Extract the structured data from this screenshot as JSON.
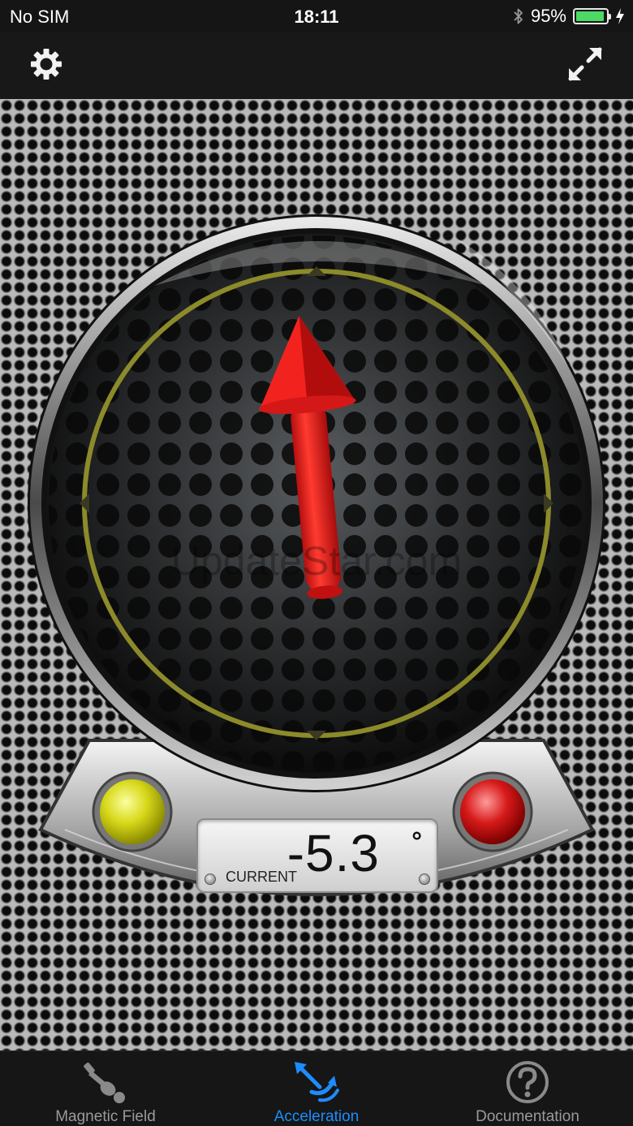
{
  "status_bar": {
    "carrier": "No SIM",
    "time": "18:11",
    "battery_percent": "95%",
    "battery_level": 0.95,
    "icons": [
      "bluetooth-icon",
      "battery-icon",
      "charging-bolt-icon"
    ]
  },
  "toolbar": {
    "left_icon": "gear-icon",
    "right_icon": "expand-arrows-icon"
  },
  "gauge": {
    "arrow_color": "#e8211e",
    "ring_color": "#8c8a2a",
    "left_light_color": "#d8d81a",
    "right_light_color": "#d71a1a",
    "reading": {
      "value": "-5.3",
      "unit": "°",
      "label": "CURRENT"
    },
    "arrow_angle_deg": -5.3
  },
  "watermark": "UpdateStar.com",
  "tabs": [
    {
      "label": "Magnetic Field",
      "icon": "magnet-probe-icon",
      "active": false
    },
    {
      "label": "Acceleration",
      "icon": "acceleration-arrows-icon",
      "active": true
    },
    {
      "label": "Documentation",
      "icon": "question-circle-icon",
      "active": false
    }
  ],
  "colors": {
    "active_tab": "#1e8cff",
    "inactive_tab": "#9a9a9a",
    "battery": "#4cd964"
  }
}
